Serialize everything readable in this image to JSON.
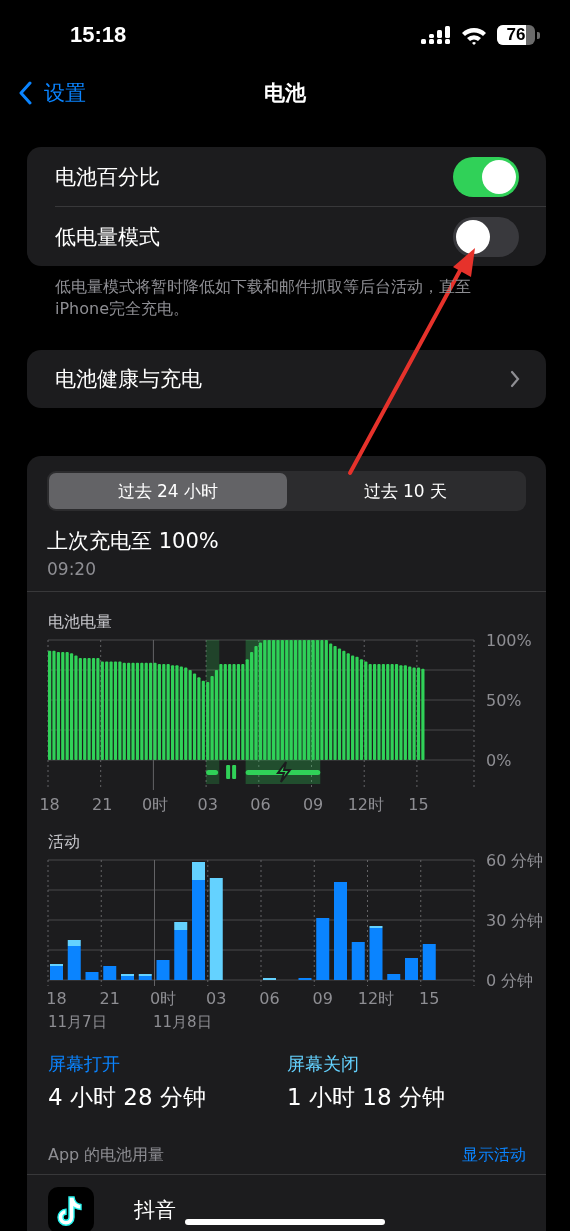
{
  "status_bar": {
    "time": "15:18",
    "battery": {
      "text": "76",
      "level": 0.76
    }
  },
  "nav": {
    "back": "设置",
    "title": "电池"
  },
  "toggles": [
    {
      "label": "电池百分比",
      "on": true
    },
    {
      "label": "低电量模式",
      "on": false
    }
  ],
  "toggles_footnote": "低电量模式将暂时降低如下载和邮件抓取等后台活动，直至iPhone完全充电。",
  "health_row": {
    "label": "电池健康与充电"
  },
  "usage": {
    "tabs": [
      {
        "label": "过去 24 小时",
        "selected": true
      },
      {
        "label": "过去 10 天",
        "selected": false
      }
    ],
    "last_charge": {
      "title": "上次充电至 100%",
      "time": "09:20"
    },
    "battery_level": {
      "chart_data": {
        "type": "bar",
        "title": "电池电量",
        "grid": true,
        "ylim": [
          0,
          100
        ],
        "categories": [
          "18",
          null,
          null,
          null,
          null,
          null,
          null,
          null,
          null,
          null,
          null,
          null,
          "21",
          null,
          null,
          null,
          null,
          null,
          null,
          null,
          null,
          null,
          null,
          null,
          "0时",
          null,
          null,
          null,
          null,
          null,
          null,
          null,
          null,
          null,
          null,
          null,
          "03",
          null,
          null,
          null,
          null,
          null,
          null,
          null,
          null,
          null,
          null,
          null,
          "06",
          null,
          null,
          null,
          null,
          null,
          null,
          null,
          null,
          null,
          null,
          null,
          "09",
          null,
          null,
          null,
          null,
          null,
          null,
          null,
          null,
          null,
          null,
          null,
          "12时",
          null,
          null,
          null,
          null,
          null,
          null,
          null,
          null,
          null,
          null,
          null,
          "15",
          null,
          null,
          null,
          null,
          null,
          null,
          null,
          null,
          null,
          null,
          null,
          null
        ],
        "values": [
          91,
          91,
          90,
          90,
          90,
          89,
          87,
          85,
          85,
          85,
          85,
          85,
          82,
          82,
          82,
          82,
          82,
          81,
          81,
          81,
          81,
          81,
          81,
          81,
          81,
          80,
          80,
          80,
          79,
          79,
          78,
          77,
          75,
          72,
          69,
          66,
          65,
          70,
          75,
          80,
          80,
          80,
          80,
          80,
          80,
          84,
          90,
          95,
          98,
          100,
          100,
          100,
          100,
          100,
          100,
          100,
          100,
          100,
          100,
          100,
          100,
          100,
          100,
          100,
          97,
          95,
          93,
          91,
          89,
          87,
          86,
          84,
          82,
          80,
          80,
          80,
          80,
          80,
          80,
          80,
          79,
          79,
          78,
          77,
          77,
          76,
          null,
          null,
          null,
          null,
          null,
          null,
          null,
          null,
          null,
          null,
          null
        ],
        "yticks": [
          {
            "value": 0,
            "label": "0%"
          },
          {
            "value": 50,
            "label": "50%"
          },
          {
            "value": 100,
            "label": "100%"
          }
        ],
        "ref_lines": [
          {
            "axis": "y",
            "value": 25
          },
          {
            "axis": "y",
            "value": 50
          },
          {
            "axis": "y",
            "value": 75
          }
        ]
      },
      "charge_segments": [
        {
          "kind": "paused"
        },
        {
          "kind": "charging"
        }
      ]
    },
    "activity": {
      "chart_data": {
        "type": "bar",
        "title": "活动",
        "stacked": true,
        "grid": true,
        "ylim": [
          0,
          60
        ],
        "categories": [
          "18",
          null,
          null,
          "21",
          null,
          null,
          "0时",
          null,
          null,
          "03",
          null,
          null,
          "06",
          null,
          null,
          "09",
          null,
          null,
          "12时",
          null,
          null,
          "15",
          null,
          null
        ],
        "series": [
          {
            "name": "屏幕打开",
            "color": "#0a84ff",
            "values": [
              7,
              17,
              4,
              7,
              2,
              2,
              10,
              25,
              50,
              0,
              0,
              0,
              0,
              0,
              1,
              31,
              49,
              19,
              26,
              3,
              11,
              18,
              null,
              null
            ]
          },
          {
            "name": "屏幕关闭",
            "color": "#64d2ff",
            "values": [
              1,
              3,
              0,
              0,
              1,
              1,
              0,
              4,
              9,
              51,
              0,
              0,
              1,
              0,
              0,
              0,
              0,
              0,
              1,
              0,
              0,
              0,
              null,
              null
            ]
          }
        ],
        "yticks": [
          {
            "value": 0,
            "label": "0 分钟"
          },
          {
            "value": 30,
            "label": "30 分钟"
          },
          {
            "value": 60,
            "label": "60 分钟"
          }
        ],
        "ref_lines": [
          {
            "axis": "y",
            "value": 15
          },
          {
            "axis": "y",
            "value": 30
          },
          {
            "axis": "y",
            "value": 45
          }
        ]
      },
      "date_labels": [
        "11月7日",
        "11月8日"
      ]
    },
    "screen": [
      {
        "value": "4 小时 28 分钟"
      },
      {
        "value": "1 小时 18 分钟"
      }
    ],
    "app_usage": {
      "title": "App 的电池用量",
      "action": "显示活动",
      "apps": [
        {
          "name": "抖音"
        }
      ]
    }
  }
}
